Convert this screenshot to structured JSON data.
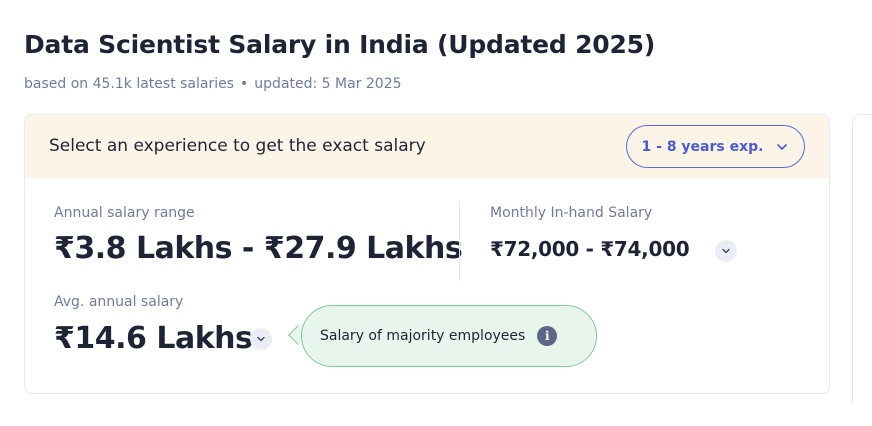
{
  "page": {
    "title": "Data Scientist Salary in India (Updated 2025)",
    "subtitle_count": "based on 45.1k latest salaries",
    "subtitle_separator": "•",
    "subtitle_updated": "updated: 5 Mar 2025"
  },
  "experience": {
    "prompt": "Select an experience to get the exact salary",
    "selected": "1 - 8 years exp."
  },
  "salary": {
    "annual_label": "Annual salary range",
    "annual_range": "₹3.8 Lakhs - ₹27.9 Lakhs",
    "monthly_label": "Monthly In-hand Salary",
    "monthly_range": "₹72,000 - ₹74,000",
    "avg_label": "Avg. annual salary",
    "avg_value": "₹14.6 Lakhs"
  },
  "tooltip": {
    "text": "Salary of majority employees",
    "icon_glyph": "i"
  },
  "colors": {
    "accent": "#4a5bd1",
    "header_bg": "#fdf4e8",
    "tooltip_bg": "#e7f5ec",
    "tooltip_border": "#7ec89a"
  },
  "icons": {
    "select_chevron": "chevron-down-icon",
    "monthly_expand": "chevron-down-icon",
    "avg_expand": "chevron-down-icon",
    "tooltip_info": "info-icon"
  }
}
